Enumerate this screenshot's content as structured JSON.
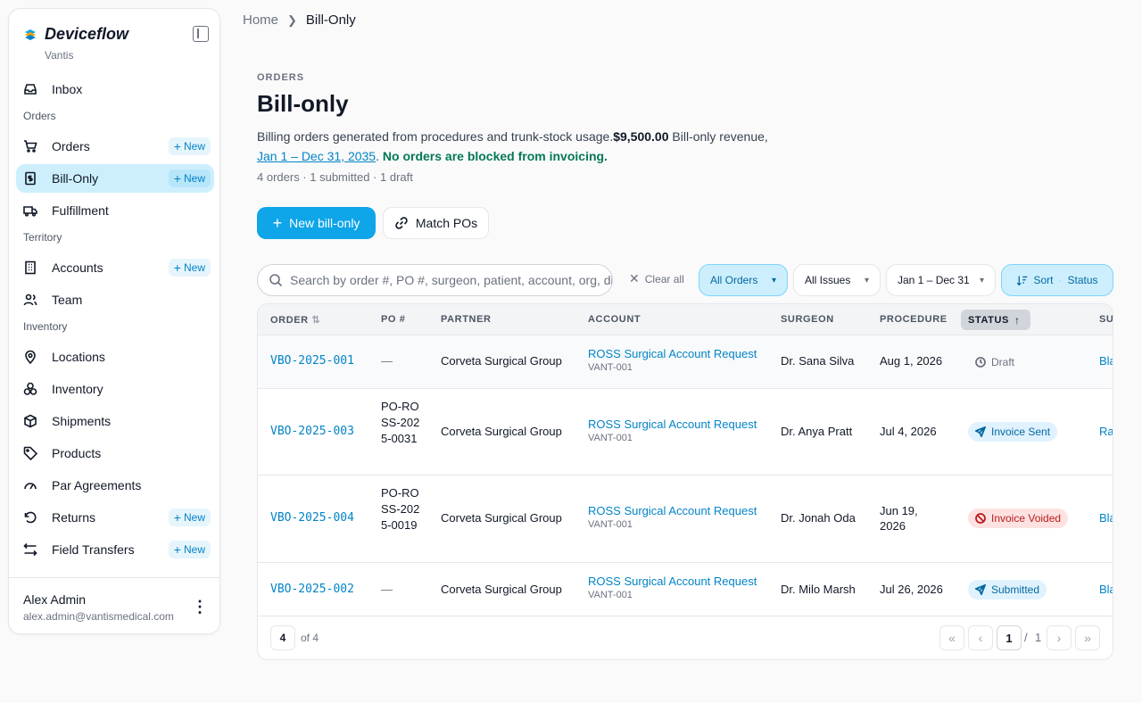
{
  "app": {
    "name": "Deviceflow",
    "org": "Vantis"
  },
  "sidebar": {
    "inbox": "Inbox",
    "sections": {
      "orders": "Orders",
      "territory": "Territory",
      "inventory": "Inventory"
    },
    "new_label": "New",
    "items": {
      "orders": "Orders",
      "bill_only": "Bill-Only",
      "fulfillment": "Fulfillment",
      "accounts": "Accounts",
      "team": "Team",
      "locations": "Locations",
      "inventory": "Inventory",
      "shipments": "Shipments",
      "products": "Products",
      "par_agreements": "Par Agreements",
      "returns": "Returns",
      "field_transfers": "Field Transfers"
    },
    "user": {
      "name": "Alex Admin",
      "email": "alex.admin@vantismedical.com"
    }
  },
  "breadcrumb": {
    "home": "Home",
    "current": "Bill-Only"
  },
  "header": {
    "eyebrow": "ORDERS",
    "title": "Bill-only",
    "desc_lead": "Billing orders generated from procedures and trunk-stock usage.",
    "revenue": "$9,500.00",
    "revenue_suffix": " Bill-only revenue,",
    "date_range": "Jan 1 – Dec 31, 2035",
    "period": ".",
    "status_note": "No orders are blocked from invoicing.",
    "meta": "4 orders · 1 submitted · 1 draft"
  },
  "actions": {
    "new_bill_only": "New bill-only",
    "match_pos": "Match POs"
  },
  "filters": {
    "search_placeholder": "Search by order #, PO #, surgeon, patient, account, org, distributor",
    "clear_all": "Clear all",
    "all_orders": "All Orders",
    "all_issues": "All Issues",
    "date": "Jan 1 – Dec 31",
    "sort_label": "Sort",
    "sort_value": "Status"
  },
  "table": {
    "columns": {
      "order": "ORDER",
      "po": "PO #",
      "partner": "PARTNER",
      "account": "ACCOUNT",
      "surgeon": "SURGEON",
      "procedure": "PROCEDURE",
      "status": "STATUS",
      "sub": "SU"
    },
    "rows": [
      {
        "order": "VBO-2025-001",
        "po": "—",
        "partner": "Corveta Surgical Group",
        "account": "ROSS Surgical Account Request",
        "account_code": "VANT-001",
        "surgeon": "Dr. Sana Silva",
        "procedure": "Aug 1, 2026",
        "status": "Draft",
        "sub": "Bla"
      },
      {
        "order": "VBO-2025-003",
        "po": "PO-ROSS-2025-0031",
        "partner": "Corveta Surgical Group",
        "account": "ROSS Surgical Account Request",
        "account_code": "VANT-001",
        "surgeon": "Dr. Anya Pratt",
        "procedure": "Jul 4, 2026",
        "status": "Invoice Sent",
        "sub": "Ra"
      },
      {
        "order": "VBO-2025-004",
        "po": "PO-ROSS-2025-0019",
        "partner": "Corveta Surgical Group",
        "account": "ROSS Surgical Account Request",
        "account_code": "VANT-001",
        "surgeon": "Dr. Jonah Oda",
        "procedure": "Jun 19, 2026",
        "status": "Invoice Voided",
        "sub": "Bla"
      },
      {
        "order": "VBO-2025-002",
        "po": "—",
        "partner": "Corveta Surgical Group",
        "account": "ROSS Surgical Account Request",
        "account_code": "VANT-001",
        "surgeon": "Dr. Milo Marsh",
        "procedure": "Jul 26, 2026",
        "status": "Submitted",
        "sub": "Bla"
      }
    ]
  },
  "pagination": {
    "page_size": "4",
    "of_total": "of 4",
    "current": "1",
    "slash": "/",
    "total": "1"
  },
  "colors": {
    "accent": "#0ea5e9",
    "active_bg": "#cdeffd",
    "link": "#0284c7",
    "success": "#047857",
    "danger": "#b91c1c"
  },
  "icons": {
    "brand": "deviceflow-logo-icon",
    "collapse": "sidebar-collapse-icon",
    "search": "search-icon"
  }
}
